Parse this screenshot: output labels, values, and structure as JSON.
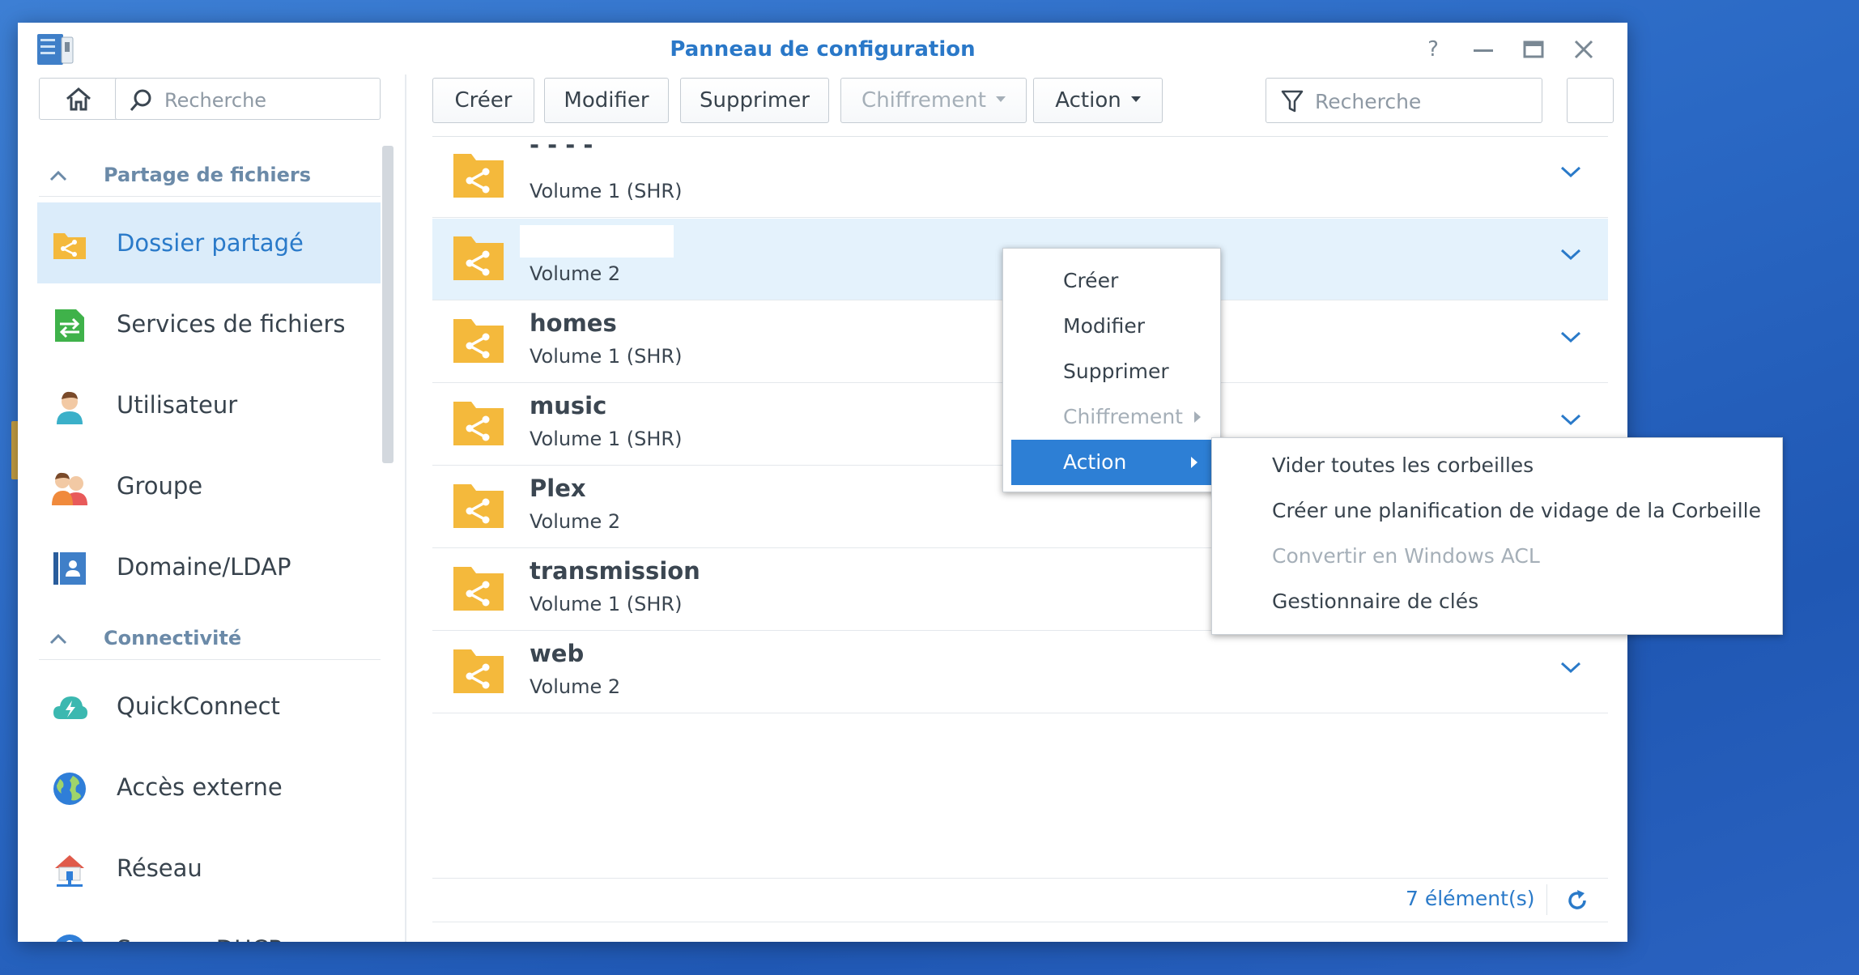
{
  "window": {
    "title": "Panneau de configuration"
  },
  "sidebar": {
    "search_placeholder": "Recherche",
    "sections": [
      {
        "label": "Partage de fichiers",
        "items": [
          "Dossier partagé",
          "Services de fichiers",
          "Utilisateur",
          "Groupe",
          "Domaine/LDAP"
        ]
      },
      {
        "label": "Connectivité",
        "items": [
          "QuickConnect",
          "Accès externe",
          "Réseau",
          "Serveur DHCP"
        ]
      }
    ],
    "active_item": "Dossier partagé"
  },
  "toolbar": {
    "create": "Créer",
    "modify": "Modifier",
    "delete": "Supprimer",
    "encryption": "Chiffrement",
    "action": "Action",
    "search_placeholder": "Recherche"
  },
  "folders": [
    {
      "name": "- - - -",
      "volume": "Volume 1 (SHR)"
    },
    {
      "name": "",
      "volume": "Volume 2"
    },
    {
      "name": "homes",
      "volume": "Volume 1 (SHR)"
    },
    {
      "name": "music",
      "volume": "Volume 1 (SHR)"
    },
    {
      "name": "Plex",
      "volume": "Volume 2"
    },
    {
      "name": "transmission",
      "volume": "Volume 1 (SHR)"
    },
    {
      "name": "web",
      "volume": "Volume 2"
    }
  ],
  "footer": {
    "count": "7 élément(s)"
  },
  "context_menu": {
    "items": [
      "Créer",
      "Modifier",
      "Supprimer",
      "Chiffrement",
      "Action"
    ],
    "highlighted": "Action",
    "disabled": [
      "Chiffrement"
    ]
  },
  "submenu": {
    "items": [
      "Vider toutes les corbeilles",
      "Créer une planification de vidage de la Corbeille",
      "Convertir en Windows ACL",
      "Gestionnaire de clés"
    ],
    "disabled": [
      "Convertir en Windows ACL"
    ]
  },
  "colors": {
    "accent": "#2a78c8",
    "highlight": "#2d7fd5",
    "folder": "#f4b93c",
    "selected_row": "#e4f2fc"
  }
}
